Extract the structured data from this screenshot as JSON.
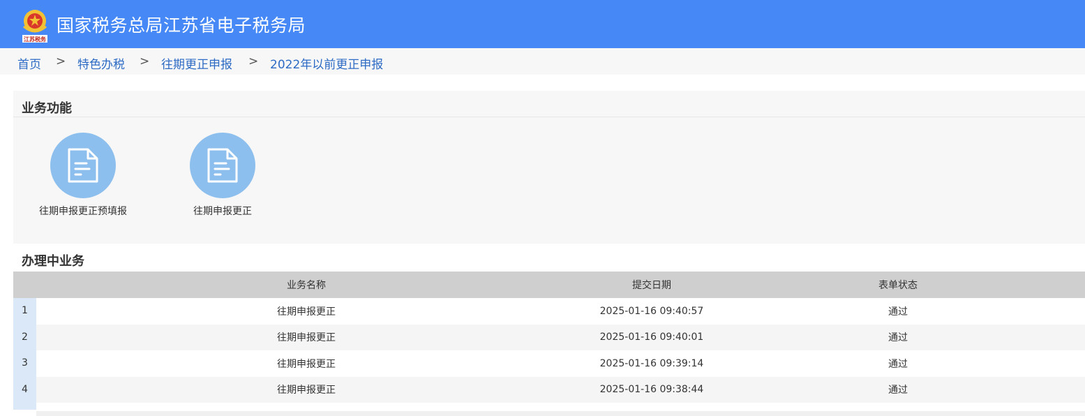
{
  "header": {
    "title": "国家税务总局江苏省电子税务局",
    "logo_caption": "江苏税务",
    "bg_color": "#4689f6"
  },
  "breadcrumb": {
    "items": [
      "首页",
      "特色办税",
      "往期更正申报",
      "2022年以前更正申报"
    ],
    "separator": ">"
  },
  "functions": {
    "title": "业务功能",
    "items": [
      {
        "label": "往期申报更正预填报",
        "icon": "document-icon"
      },
      {
        "label": "往期申报更正",
        "icon": "document-icon"
      }
    ]
  },
  "inprogress": {
    "title": "办理中业务",
    "columns": [
      "业务名称",
      "提交日期",
      "表单状态"
    ],
    "rows": [
      {
        "index": "1",
        "name": "往期申报更正",
        "date": "2025-01-16 09:40:57",
        "status": "通过"
      },
      {
        "index": "2",
        "name": "往期申报更正",
        "date": "2025-01-16 09:40:01",
        "status": "通过"
      },
      {
        "index": "3",
        "name": "往期申报更正",
        "date": "2025-01-16 09:39:14",
        "status": "通过"
      },
      {
        "index": "4",
        "name": "往期申报更正",
        "date": "2025-01-16 09:38:44",
        "status": "通过"
      }
    ]
  }
}
